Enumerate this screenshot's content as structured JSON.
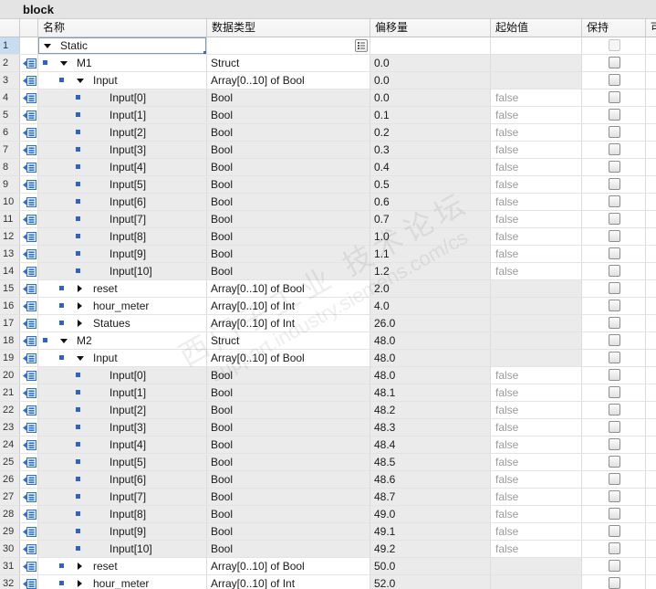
{
  "window": {
    "title": "block"
  },
  "columns": {
    "name": "名称",
    "type": "数据类型",
    "offset": "偏移量",
    "start": "起始值",
    "retain": "保持",
    "more": "可"
  },
  "colors": {
    "title_bg": "#e4e4e4",
    "header_bg": "#f2f2f2",
    "readonly_bg": "#ebebeb",
    "grid": "#dcdcdc",
    "bullet": "#2f62c8",
    "icon_blue": "#2e6fd0",
    "muted": "#9a9a9a",
    "selection": "#c9ddf2",
    "rownum_bg": "#ebebeb"
  },
  "watermark": {
    "line1": "西门子工业 技术论坛",
    "line2": "support.industry.siemens.com/cs"
  },
  "rows": [
    {
      "num": "1",
      "name": "Static",
      "depth": 0,
      "expand": "expanded",
      "icon": "",
      "type": "",
      "offset": "",
      "start": "",
      "retain": false,
      "retain_enabled": false,
      "selected": true,
      "type_button": "list-icon"
    },
    {
      "num": "2",
      "name": "M1",
      "depth": 1,
      "expand": "expanded",
      "icon": "interface-icon",
      "type": "Struct",
      "offset": "0.0",
      "start": "",
      "retain": false,
      "retain_enabled": true
    },
    {
      "num": "3",
      "name": "Input",
      "depth": 2,
      "expand": "expanded",
      "icon": "interface-icon",
      "type": "Array[0..10] of Bool",
      "offset": "0.0",
      "start": "",
      "retain": false,
      "retain_enabled": true
    },
    {
      "num": "4",
      "name": "Input[0]",
      "depth": 3,
      "expand": "none",
      "icon": "interface-icon",
      "type": "Bool",
      "offset": "0.0",
      "start": "false",
      "retain": false,
      "retain_enabled": true
    },
    {
      "num": "5",
      "name": "Input[1]",
      "depth": 3,
      "expand": "none",
      "icon": "interface-icon",
      "type": "Bool",
      "offset": "0.1",
      "start": "false",
      "retain": false,
      "retain_enabled": true
    },
    {
      "num": "6",
      "name": "Input[2]",
      "depth": 3,
      "expand": "none",
      "icon": "interface-icon",
      "type": "Bool",
      "offset": "0.2",
      "start": "false",
      "retain": false,
      "retain_enabled": true
    },
    {
      "num": "7",
      "name": "Input[3]",
      "depth": 3,
      "expand": "none",
      "icon": "interface-icon",
      "type": "Bool",
      "offset": "0.3",
      "start": "false",
      "retain": false,
      "retain_enabled": true
    },
    {
      "num": "8",
      "name": "Input[4]",
      "depth": 3,
      "expand": "none",
      "icon": "interface-icon",
      "type": "Bool",
      "offset": "0.4",
      "start": "false",
      "retain": false,
      "retain_enabled": true
    },
    {
      "num": "9",
      "name": "Input[5]",
      "depth": 3,
      "expand": "none",
      "icon": "interface-icon",
      "type": "Bool",
      "offset": "0.5",
      "start": "false",
      "retain": false,
      "retain_enabled": true
    },
    {
      "num": "10",
      "name": "Input[6]",
      "depth": 3,
      "expand": "none",
      "icon": "interface-icon",
      "type": "Bool",
      "offset": "0.6",
      "start": "false",
      "retain": false,
      "retain_enabled": true
    },
    {
      "num": "11",
      "name": "Input[7]",
      "depth": 3,
      "expand": "none",
      "icon": "interface-icon",
      "type": "Bool",
      "offset": "0.7",
      "start": "false",
      "retain": false,
      "retain_enabled": true
    },
    {
      "num": "12",
      "name": "Input[8]",
      "depth": 3,
      "expand": "none",
      "icon": "interface-icon",
      "type": "Bool",
      "offset": "1.0",
      "start": "false",
      "retain": false,
      "retain_enabled": true
    },
    {
      "num": "13",
      "name": "Input[9]",
      "depth": 3,
      "expand": "none",
      "icon": "interface-icon",
      "type": "Bool",
      "offset": "1.1",
      "start": "false",
      "retain": false,
      "retain_enabled": true
    },
    {
      "num": "14",
      "name": "Input[10]",
      "depth": 3,
      "expand": "none",
      "icon": "interface-icon",
      "type": "Bool",
      "offset": "1.2",
      "start": "false",
      "retain": false,
      "retain_enabled": true
    },
    {
      "num": "15",
      "name": "reset",
      "depth": 2,
      "expand": "collapsed",
      "icon": "interface-icon",
      "type": "Array[0..10] of Bool",
      "offset": "2.0",
      "start": "",
      "retain": false,
      "retain_enabled": true
    },
    {
      "num": "16",
      "name": "hour_meter",
      "depth": 2,
      "expand": "collapsed",
      "icon": "interface-icon",
      "type": "Array[0..10] of Int",
      "offset": "4.0",
      "start": "",
      "retain": false,
      "retain_enabled": true
    },
    {
      "num": "17",
      "name": "Statues",
      "depth": 2,
      "expand": "collapsed",
      "icon": "interface-icon",
      "type": "Array[0..10] of Int",
      "offset": "26.0",
      "start": "",
      "retain": false,
      "retain_enabled": true
    },
    {
      "num": "18",
      "name": "M2",
      "depth": 1,
      "expand": "expanded",
      "icon": "interface-icon",
      "type": "Struct",
      "offset": "48.0",
      "start": "",
      "retain": false,
      "retain_enabled": true
    },
    {
      "num": "19",
      "name": "Input",
      "depth": 2,
      "expand": "expanded",
      "icon": "interface-icon",
      "type": "Array[0..10] of Bool",
      "offset": "48.0",
      "start": "",
      "retain": false,
      "retain_enabled": true
    },
    {
      "num": "20",
      "name": "Input[0]",
      "depth": 3,
      "expand": "none",
      "icon": "interface-icon",
      "type": "Bool",
      "offset": "48.0",
      "start": "false",
      "retain": false,
      "retain_enabled": true
    },
    {
      "num": "21",
      "name": "Input[1]",
      "depth": 3,
      "expand": "none",
      "icon": "interface-icon",
      "type": "Bool",
      "offset": "48.1",
      "start": "false",
      "retain": false,
      "retain_enabled": true
    },
    {
      "num": "22",
      "name": "Input[2]",
      "depth": 3,
      "expand": "none",
      "icon": "interface-icon",
      "type": "Bool",
      "offset": "48.2",
      "start": "false",
      "retain": false,
      "retain_enabled": true
    },
    {
      "num": "23",
      "name": "Input[3]",
      "depth": 3,
      "expand": "none",
      "icon": "interface-icon",
      "type": "Bool",
      "offset": "48.3",
      "start": "false",
      "retain": false,
      "retain_enabled": true
    },
    {
      "num": "24",
      "name": "Input[4]",
      "depth": 3,
      "expand": "none",
      "icon": "interface-icon",
      "type": "Bool",
      "offset": "48.4",
      "start": "false",
      "retain": false,
      "retain_enabled": true
    },
    {
      "num": "25",
      "name": "Input[5]",
      "depth": 3,
      "expand": "none",
      "icon": "interface-icon",
      "type": "Bool",
      "offset": "48.5",
      "start": "false",
      "retain": false,
      "retain_enabled": true
    },
    {
      "num": "26",
      "name": "Input[6]",
      "depth": 3,
      "expand": "none",
      "icon": "interface-icon",
      "type": "Bool",
      "offset": "48.6",
      "start": "false",
      "retain": false,
      "retain_enabled": true
    },
    {
      "num": "27",
      "name": "Input[7]",
      "depth": 3,
      "expand": "none",
      "icon": "interface-icon",
      "type": "Bool",
      "offset": "48.7",
      "start": "false",
      "retain": false,
      "retain_enabled": true
    },
    {
      "num": "28",
      "name": "Input[8]",
      "depth": 3,
      "expand": "none",
      "icon": "interface-icon",
      "type": "Bool",
      "offset": "49.0",
      "start": "false",
      "retain": false,
      "retain_enabled": true
    },
    {
      "num": "29",
      "name": "Input[9]",
      "depth": 3,
      "expand": "none",
      "icon": "interface-icon",
      "type": "Bool",
      "offset": "49.1",
      "start": "false",
      "retain": false,
      "retain_enabled": true
    },
    {
      "num": "30",
      "name": "Input[10]",
      "depth": 3,
      "expand": "none",
      "icon": "interface-icon",
      "type": "Bool",
      "offset": "49.2",
      "start": "false",
      "retain": false,
      "retain_enabled": true
    },
    {
      "num": "31",
      "name": "reset",
      "depth": 2,
      "expand": "collapsed",
      "icon": "interface-icon",
      "type": "Array[0..10] of Bool",
      "offset": "50.0",
      "start": "",
      "retain": false,
      "retain_enabled": true
    },
    {
      "num": "32",
      "name": "hour_meter",
      "depth": 2,
      "expand": "collapsed",
      "icon": "interface-icon",
      "type": "Array[0..10] of Int",
      "offset": "52.0",
      "start": "",
      "retain": false,
      "retain_enabled": true
    }
  ]
}
